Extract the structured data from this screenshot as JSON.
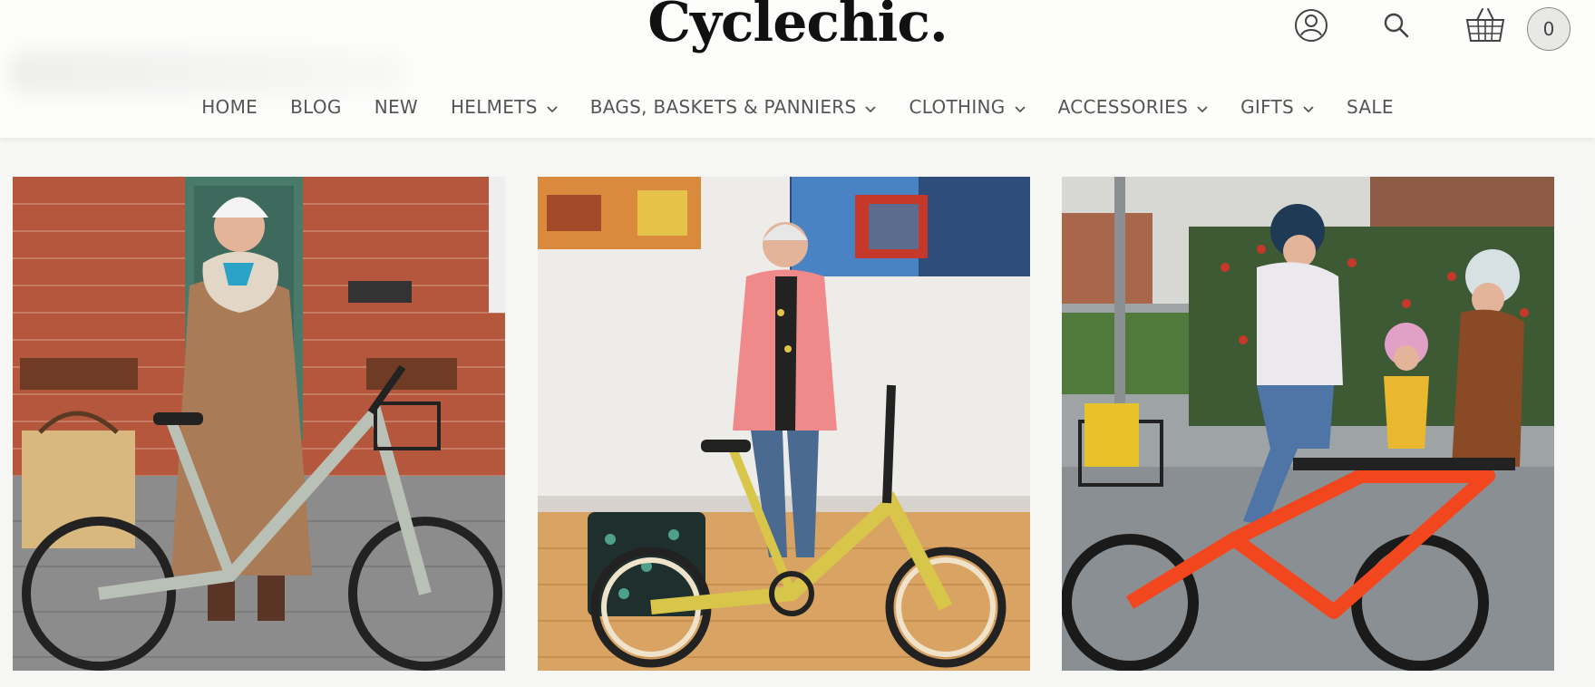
{
  "brand": {
    "name": "Cyclechic."
  },
  "header": {
    "account_icon": "account-icon",
    "search_icon": "search-icon",
    "cart_icon": "basket-icon",
    "cart_count": "0"
  },
  "nav": {
    "items": [
      {
        "label": "HOME",
        "dropdown": false
      },
      {
        "label": "BLOG",
        "dropdown": false
      },
      {
        "label": "NEW",
        "dropdown": false
      },
      {
        "label": "HELMETS",
        "dropdown": true
      },
      {
        "label": "BAGS, BASKETS & PANNIERS",
        "dropdown": true
      },
      {
        "label": "CLOTHING",
        "dropdown": true
      },
      {
        "label": "ACCESSORIES",
        "dropdown": true
      },
      {
        "label": "GIFTS",
        "dropdown": true
      },
      {
        "label": "SALE",
        "dropdown": false
      }
    ]
  },
  "colors": {
    "header_bg": "#fdfdfc",
    "page_bg": "#f6f6f4",
    "text": "#555555",
    "logo": "#111111"
  }
}
